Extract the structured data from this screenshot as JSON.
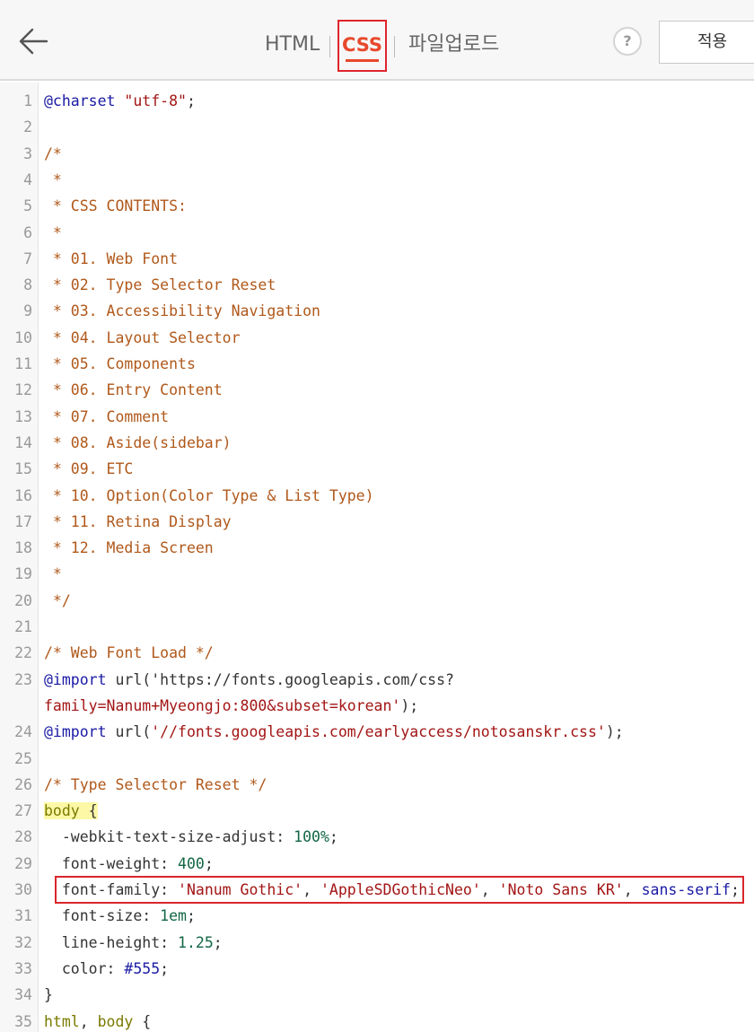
{
  "header": {
    "tabs": [
      {
        "label": "HTML"
      },
      {
        "label": "CSS"
      },
      {
        "label": "파일업로드"
      }
    ],
    "help_label": "?",
    "apply_label": "적용",
    "accent_color": "#e8482c"
  },
  "editor": {
    "lines": [
      {
        "n": "1",
        "t": "@charset \"utf-8\";"
      },
      {
        "n": "2",
        "t": ""
      },
      {
        "n": "3",
        "t": "/*"
      },
      {
        "n": "4",
        "t": " *"
      },
      {
        "n": "5",
        "t": " * CSS CONTENTS:"
      },
      {
        "n": "6",
        "t": " *"
      },
      {
        "n": "7",
        "t": " * 01. Web Font"
      },
      {
        "n": "8",
        "t": " * 02. Type Selector Reset"
      },
      {
        "n": "9",
        "t": " * 03. Accessibility Navigation"
      },
      {
        "n": "10",
        "t": " * 04. Layout Selector"
      },
      {
        "n": "11",
        "t": " * 05. Components"
      },
      {
        "n": "12",
        "t": " * 06. Entry Content"
      },
      {
        "n": "13",
        "t": " * 07. Comment"
      },
      {
        "n": "14",
        "t": " * 08. Aside(sidebar)"
      },
      {
        "n": "15",
        "t": " * 09. ETC"
      },
      {
        "n": "16",
        "t": " * 10. Option(Color Type & List Type)"
      },
      {
        "n": "17",
        "t": " * 11. Retina Display"
      },
      {
        "n": "18",
        "t": " * 12. Media Screen"
      },
      {
        "n": "19",
        "t": " *"
      },
      {
        "n": "20",
        "t": " */"
      },
      {
        "n": "21",
        "t": ""
      },
      {
        "n": "22",
        "t": "/* Web Font Load */"
      },
      {
        "n": "23",
        "t": "@import url('https://fonts.googleapis.com/css?"
      },
      {
        "n": "",
        "t": "family=Nanum+Myeongjo:800&subset=korean');"
      },
      {
        "n": "24",
        "t": "@import url('//fonts.googleapis.com/earlyaccess/notosanskr.css');"
      },
      {
        "n": "25",
        "t": ""
      },
      {
        "n": "26",
        "t": "/* Type Selector Reset */"
      },
      {
        "n": "27",
        "t": "body {"
      },
      {
        "n": "28",
        "t": "  -webkit-text-size-adjust: 100%;"
      },
      {
        "n": "29",
        "t": "  font-weight: 400;"
      },
      {
        "n": "30",
        "t": "  font-family: 'Nanum Gothic', 'AppleSDGothicNeo', 'Noto Sans KR', sans-serif;"
      },
      {
        "n": "31",
        "t": "  font-size: 1em;"
      },
      {
        "n": "32",
        "t": "  line-height: 1.25;"
      },
      {
        "n": "33",
        "t": "  color: #555;"
      },
      {
        "n": "34",
        "t": "}"
      },
      {
        "n": "35",
        "t": "html, body {"
      }
    ]
  }
}
